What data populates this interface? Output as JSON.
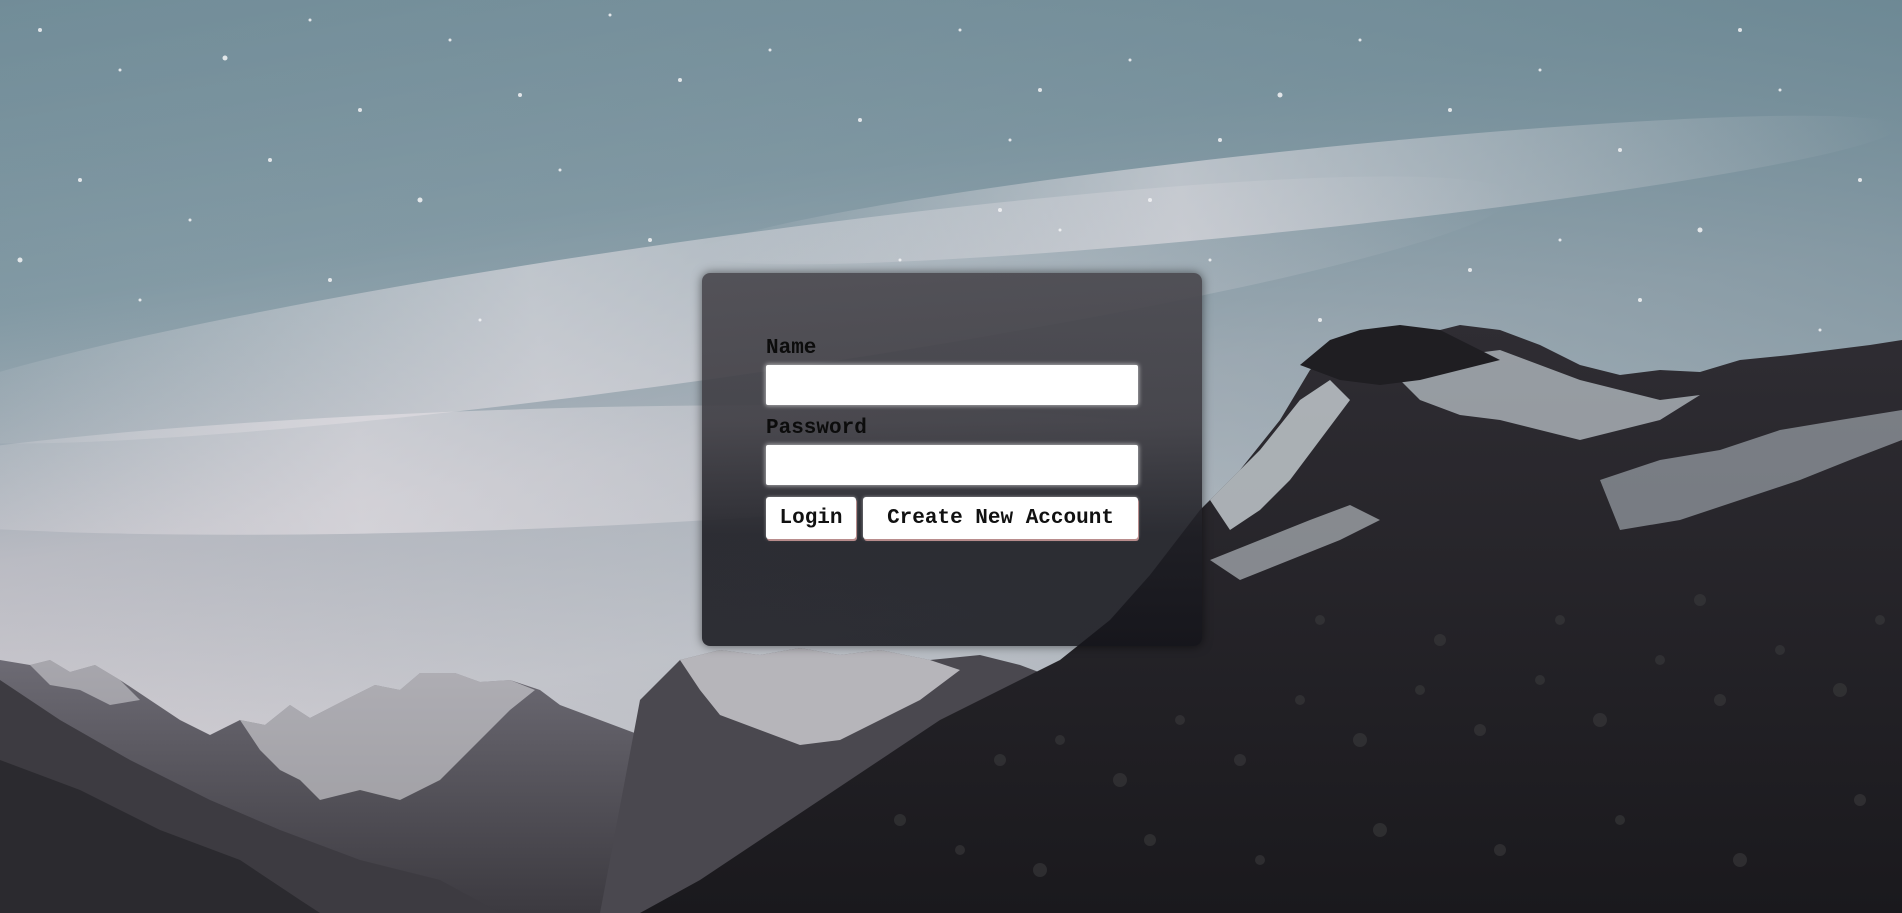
{
  "background": {
    "description_icon": "mountain-landscape-image",
    "sky_color": "#6f8a97",
    "mountain_color": "#2b2a30"
  },
  "form": {
    "name_label": "Name",
    "name_value": "",
    "password_label": "Password",
    "password_value": "",
    "login_label": "Login",
    "create_account_label": "Create New Account"
  }
}
